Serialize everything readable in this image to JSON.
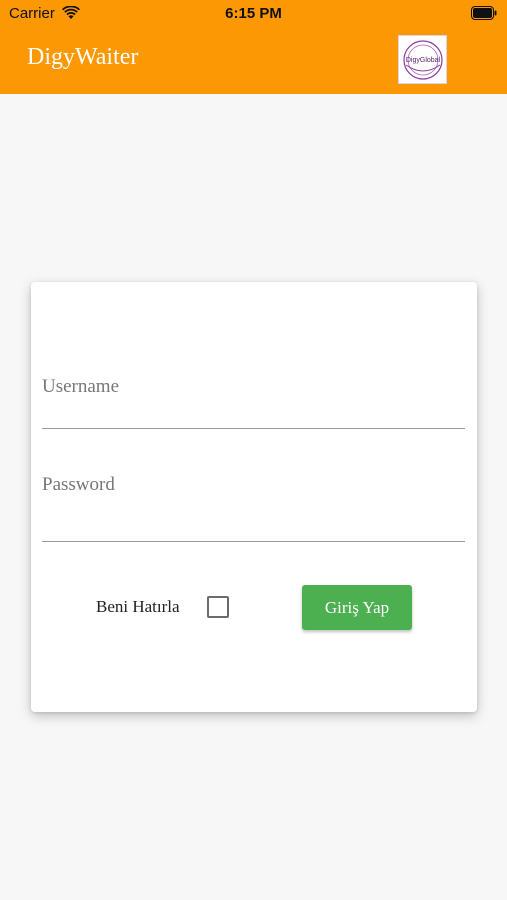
{
  "status_bar": {
    "carrier": "Carrier",
    "time": "6:15 PM"
  },
  "app_bar": {
    "title": "DigyWaiter",
    "logo_text": "DigyGlobal"
  },
  "login_form": {
    "username_placeholder": "Username",
    "password_placeholder": "Password",
    "remember_label": "Beni Hatırla",
    "remember_checked": false,
    "login_button": "Giriş Yap"
  },
  "colors": {
    "accent": "#fb9804",
    "button": "#4caf50",
    "background": "#f7f7f7"
  },
  "icons": {
    "wifi": "wifi-icon",
    "battery": "battery-icon",
    "logo": "digyglobal-logo"
  }
}
